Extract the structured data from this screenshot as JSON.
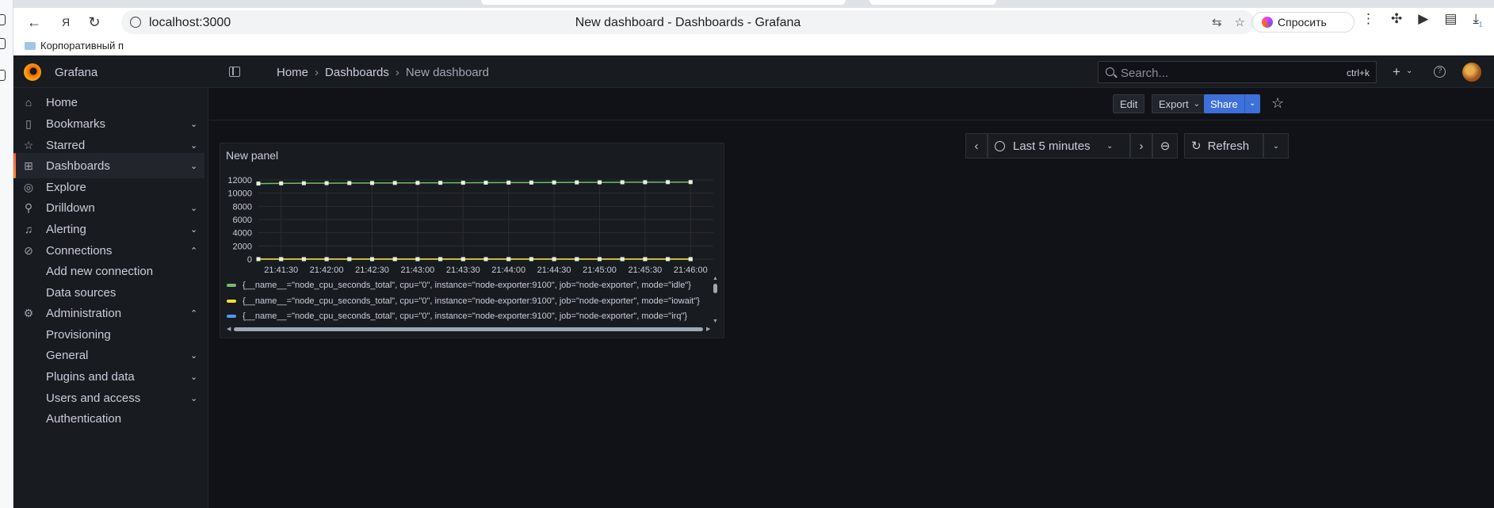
{
  "browser": {
    "url": "localhost:3000",
    "page_title": "New dashboard - Dashboards - Grafana",
    "ask_label": "Спросить",
    "bookmark_label": "Корпоративный п",
    "download_badge": "1"
  },
  "grafana": {
    "brand": "Grafana",
    "breadcrumb": [
      "Home",
      "Dashboards",
      "New dashboard"
    ],
    "search_placeholder": "Search...",
    "search_shortcut": "ctrl+k"
  },
  "sidebar": {
    "items": [
      {
        "label": "Home",
        "icon": "home-icon",
        "chevron": ""
      },
      {
        "label": "Bookmarks",
        "icon": "bookmark-icon",
        "chevron": "down"
      },
      {
        "label": "Starred",
        "icon": "star-icon",
        "chevron": "down"
      },
      {
        "label": "Dashboards",
        "icon": "apps-icon",
        "chevron": "down",
        "active": true
      },
      {
        "label": "Explore",
        "icon": "compass-icon",
        "chevron": ""
      },
      {
        "label": "Drilldown",
        "icon": "drilldown-icon",
        "chevron": "down"
      },
      {
        "label": "Alerting",
        "icon": "bell-icon",
        "chevron": "down"
      },
      {
        "label": "Connections",
        "icon": "connections-icon",
        "chevron": "up"
      },
      {
        "label": "Add new connection",
        "icon": "",
        "chevron": ""
      },
      {
        "label": "Data sources",
        "icon": "",
        "chevron": ""
      },
      {
        "label": "Administration",
        "icon": "cog-icon",
        "chevron": "up"
      },
      {
        "label": "Provisioning",
        "icon": "",
        "chevron": ""
      },
      {
        "label": "General",
        "icon": "",
        "chevron": "down"
      },
      {
        "label": "Plugins and data",
        "icon": "",
        "chevron": "down"
      },
      {
        "label": "Users and access",
        "icon": "",
        "chevron": "down"
      },
      {
        "label": "Authentication",
        "icon": "",
        "chevron": ""
      }
    ]
  },
  "toolbar": {
    "edit_label": "Edit",
    "export_label": "Export",
    "share_label": "Share"
  },
  "timepicker": {
    "range_label": "Last 5 minutes",
    "refresh_label": "Refresh"
  },
  "panel": {
    "title": "New panel",
    "legend": [
      {
        "label": "{__name__=\"node_cpu_seconds_total\", cpu=\"0\", instance=\"node-exporter:9100\", job=\"node-exporter\", mode=\"idle\"}",
        "color": "#73bf69"
      },
      {
        "label": "{__name__=\"node_cpu_seconds_total\", cpu=\"0\", instance=\"node-exporter:9100\", job=\"node-exporter\", mode=\"iowait\"}",
        "color": "#fade2a"
      },
      {
        "label": "{__name__=\"node_cpu_seconds_total\", cpu=\"0\", instance=\"node-exporter:9100\", job=\"node-exporter\", mode=\"irq\"}",
        "color": "#5794f2"
      }
    ]
  },
  "chart_data": {
    "type": "line",
    "x_ticks": [
      "21:41:30",
      "21:42:00",
      "21:42:30",
      "21:43:00",
      "21:43:30",
      "21:44:00",
      "21:44:30",
      "21:45:00",
      "21:45:30",
      "21:46:00"
    ],
    "y_ticks": [
      0,
      2000,
      4000,
      6000,
      8000,
      10000,
      12000
    ],
    "ylim": [
      0,
      12000
    ],
    "x_start": "21:41:15",
    "x_end": "21:46:15",
    "points_x": [
      "21:41:15",
      "21:41:30",
      "21:41:45",
      "21:42:00",
      "21:42:15",
      "21:42:30",
      "21:42:45",
      "21:43:00",
      "21:43:15",
      "21:43:30",
      "21:43:45",
      "21:44:00",
      "21:44:15",
      "21:44:30",
      "21:44:45",
      "21:45:00",
      "21:45:15",
      "21:45:30",
      "21:45:45",
      "21:46:00"
    ],
    "series": [
      {
        "name": "{__name__=\"node_cpu_seconds_total\", cpu=\"0\", instance=\"node-exporter:9100\", job=\"node-exporter\", mode=\"idle\"}",
        "color": "#73bf69",
        "values": [
          11450,
          11480,
          11500,
          11510,
          11520,
          11530,
          11540,
          11550,
          11560,
          11570,
          11580,
          11590,
          11600,
          11610,
          11620,
          11630,
          11640,
          11650,
          11660,
          11670
        ]
      },
      {
        "name": "{__name__=\"node_cpu_seconds_total\", cpu=\"0\", instance=\"node-exporter:9100\", job=\"node-exporter\", mode=\"iowait\"}",
        "color": "#fade2a",
        "values": [
          10,
          10,
          10,
          10,
          10,
          10,
          10,
          10,
          10,
          10,
          10,
          10,
          10,
          10,
          10,
          10,
          10,
          10,
          10,
          10
        ]
      },
      {
        "name": "{__name__=\"node_cpu_seconds_total\", cpu=\"0\", instance=\"node-exporter:9100\", job=\"node-exporter\", mode=\"irq\"}",
        "color": "#5794f2",
        "values": [
          0,
          0,
          0,
          0,
          0,
          0,
          0,
          0,
          0,
          0,
          0,
          0,
          0,
          0,
          0,
          0,
          0,
          0,
          0,
          0
        ]
      }
    ],
    "grid": true,
    "legend_position": "bottom"
  }
}
